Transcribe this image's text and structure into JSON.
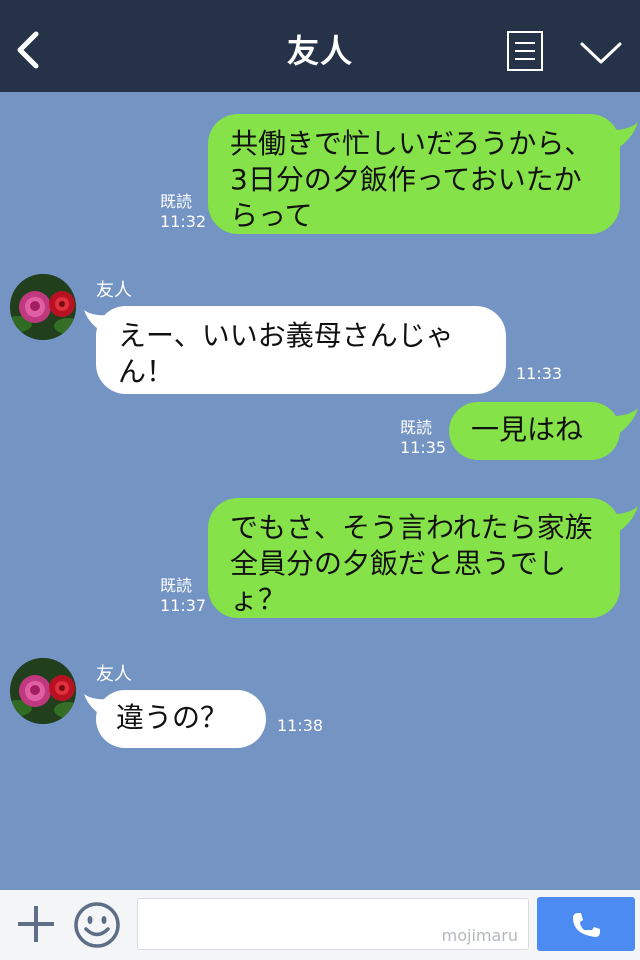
{
  "header": {
    "title": "友人"
  },
  "messages": [
    {
      "text": "共働きで忙しいだろうから、3日分の夕飯作っておいたからって",
      "read": "既読",
      "time": "11:32"
    },
    {
      "sender": "友人",
      "text": "えー、いいお義母さんじゃん！",
      "time": "11:33"
    },
    {
      "text": "一見はね",
      "read": "既読",
      "time": "11:35"
    },
    {
      "text": "でもさ、そう言われたら家族全員分の夕飯だと思うでしょ？",
      "read": "既読",
      "time": "11:37"
    },
    {
      "sender": "友人",
      "text": "違うの？",
      "time": "11:38"
    }
  ],
  "footer": {
    "watermark": "mojimaru"
  },
  "colors": {
    "header": "#263248",
    "background": "#7494c4",
    "sent": "#85e249",
    "received": "#ffffff",
    "send_button": "#4c8cf2"
  },
  "icons": [
    "back-icon",
    "menu-icon",
    "chevron-down-icon",
    "plus-icon",
    "emoji-icon",
    "phone-icon"
  ]
}
